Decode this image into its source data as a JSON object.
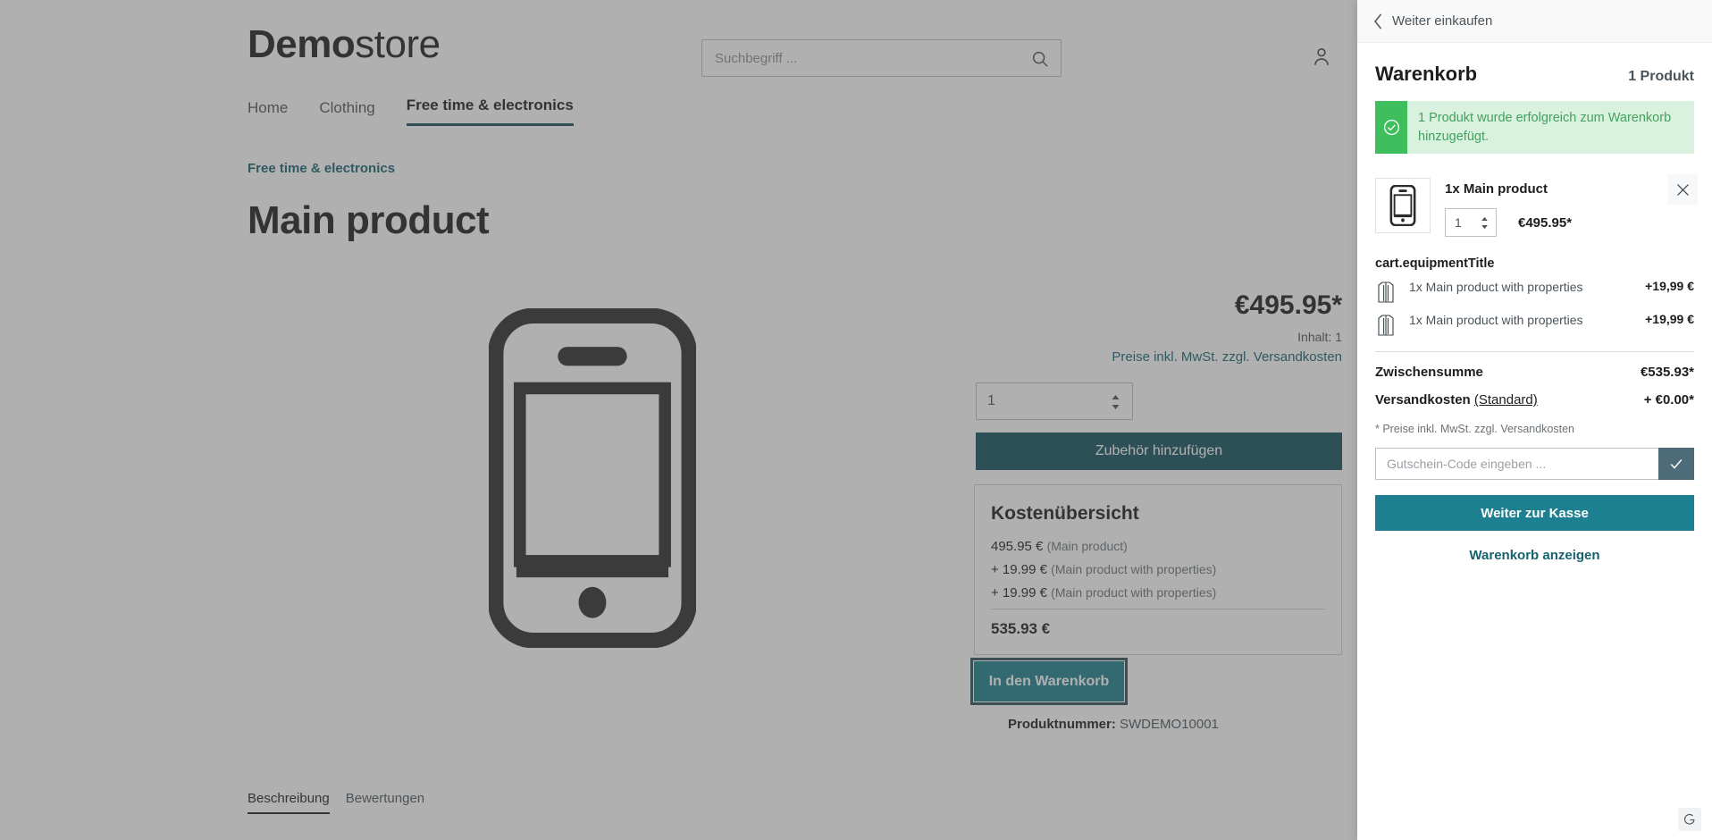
{
  "shop": {
    "logo_bold": "Demo",
    "logo_light": "store",
    "search_placeholder": "Suchbegriff ...",
    "search_value": "",
    "nav": [
      {
        "label": "Home",
        "active": false
      },
      {
        "label": "Clothing",
        "active": false
      },
      {
        "label": "Free time & electronics",
        "active": true
      }
    ],
    "breadcrumb": "Free time & electronics",
    "product_title": "Main product",
    "price": "€495.95*",
    "content_label": "Inhalt: 1",
    "tax_link": "Preise inkl. MwSt. zzgl. Versandkosten",
    "quantity": "1",
    "accessory_button": "Zubehör hinzufügen",
    "cost_overview": {
      "heading": "Kostenübersicht",
      "lines": [
        {
          "amount": "495.95 €",
          "note": "(Main product)"
        },
        {
          "amount": "+ 19.99 €",
          "note": "(Main product with properties)"
        },
        {
          "amount": "+ 19.99 €",
          "note": "(Main product with properties)"
        }
      ],
      "total": "535.93 €"
    },
    "add_to_cart": "In den Warenkorb",
    "product_number_label": "Produktnummer:",
    "product_number_value": "SWDEMO10001",
    "tabs": [
      {
        "label": "Beschreibung",
        "active": true
      },
      {
        "label": "Bewertungen",
        "active": false
      }
    ]
  },
  "cart": {
    "back_label": "Weiter einkaufen",
    "title": "Warenkorb",
    "count": "1 Produkt",
    "alert": "1 Produkt wurde erfolgreich zum Warenkorb hinzugefügt.",
    "item": {
      "name": "1x Main product",
      "quantity": "1",
      "price": "€495.95*"
    },
    "equipment_title": "cart.equipmentTitle",
    "equipment": [
      {
        "name": "1x Main product with properties",
        "price": "+19,99 €"
      },
      {
        "name": "1x Main product with properties",
        "price": "+19,99 €"
      }
    ],
    "subtotal_label": "Zwischensumme",
    "subtotal_value": "€535.93*",
    "shipping_label": "Versandkosten",
    "shipping_note": "(Standard)",
    "shipping_value": "+ €0.00*",
    "tax_note": "* Preise inkl. MwSt. zzgl. Versandkosten",
    "coupon_placeholder": "Gutschein-Code eingeben ...",
    "coupon_value": "",
    "checkout_button": "Weiter zur Kasse",
    "view_cart_link": "Warenkorb anzeigen"
  },
  "colors": {
    "teal_dark": "#12505d",
    "teal": "#1c8091",
    "link": "#16626f",
    "success": "#3fbe5e",
    "success_bg": "#d9f2df"
  }
}
